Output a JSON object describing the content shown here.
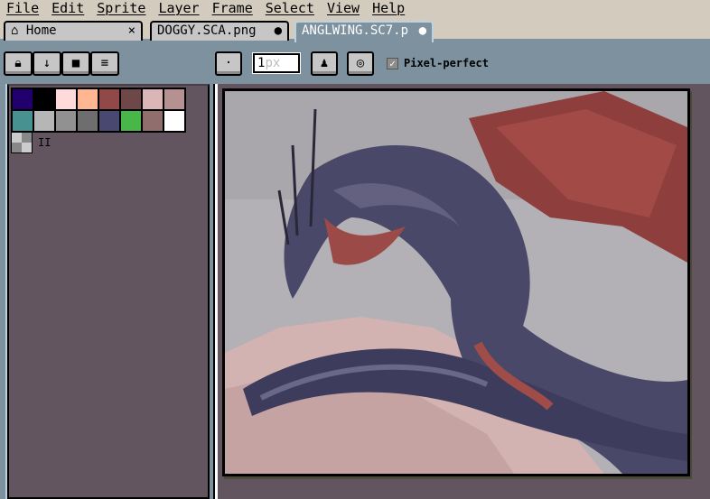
{
  "menu": [
    "File",
    "Edit",
    "Sprite",
    "Layer",
    "Frame",
    "Select",
    "View",
    "Help"
  ],
  "tabs": [
    {
      "label": "Home",
      "icon": "home-icon",
      "close": "×"
    },
    {
      "label": "DOGGY.SCA.png",
      "modified": "●"
    },
    {
      "label": "ANGLWING.SC7.p",
      "modified": "●",
      "active": true
    }
  ],
  "layer_buttons": [
    {
      "icon": "lock-icon"
    },
    {
      "icon": "arrow-down-icon"
    },
    {
      "icon": "square-icon"
    },
    {
      "icon": "menu-icon"
    }
  ],
  "toolbar": {
    "brush_type": "·",
    "size_value": "1",
    "size_unit": "px",
    "pixel_perfect_label": "Pixel-perfect",
    "pixel_perfect_checked": true,
    "check": "✓"
  },
  "palette": [
    "#21006e",
    "#000000",
    "#ffdada",
    "#ffb691",
    "#914948",
    "#6e4848",
    "#dbb6b6",
    "#b69191",
    "#489191",
    "#b6b6b6",
    "#919191",
    "#6e6e6e",
    "#484870",
    "#48b648",
    "#916e6e",
    "#ffffff"
  ],
  "pause_glyph": "II",
  "colors": {
    "toolbar": "#7d929e",
    "panel": "#625560",
    "menubar": "#d3cbbd"
  }
}
